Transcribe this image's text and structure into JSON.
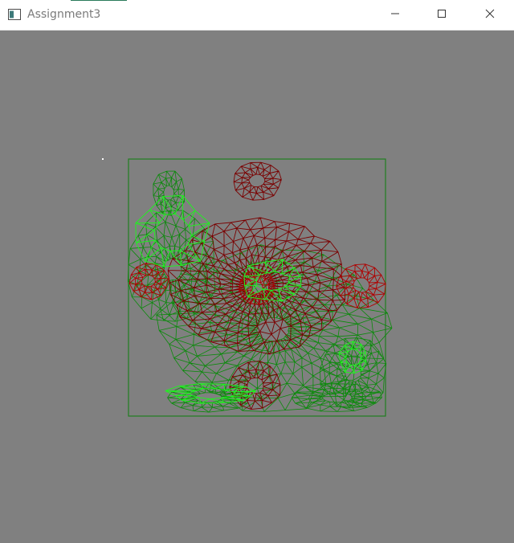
{
  "window": {
    "title": "Assignment3",
    "icons": {
      "app": "app-window-icon",
      "minimize": "minimize-icon",
      "maximize": "maximize-icon",
      "close": "close-icon"
    }
  },
  "viewport": {
    "background": "#808080",
    "content": "wireframe-mesh",
    "colors": {
      "mesh_red": "#b00000",
      "mesh_dark_red": "#7a0000",
      "mesh_green": "#0a8a0a",
      "mesh_bright_green": "#22ee22",
      "bounding_box": "#1f7f1f",
      "cursor_marker": "#ffffff"
    }
  }
}
